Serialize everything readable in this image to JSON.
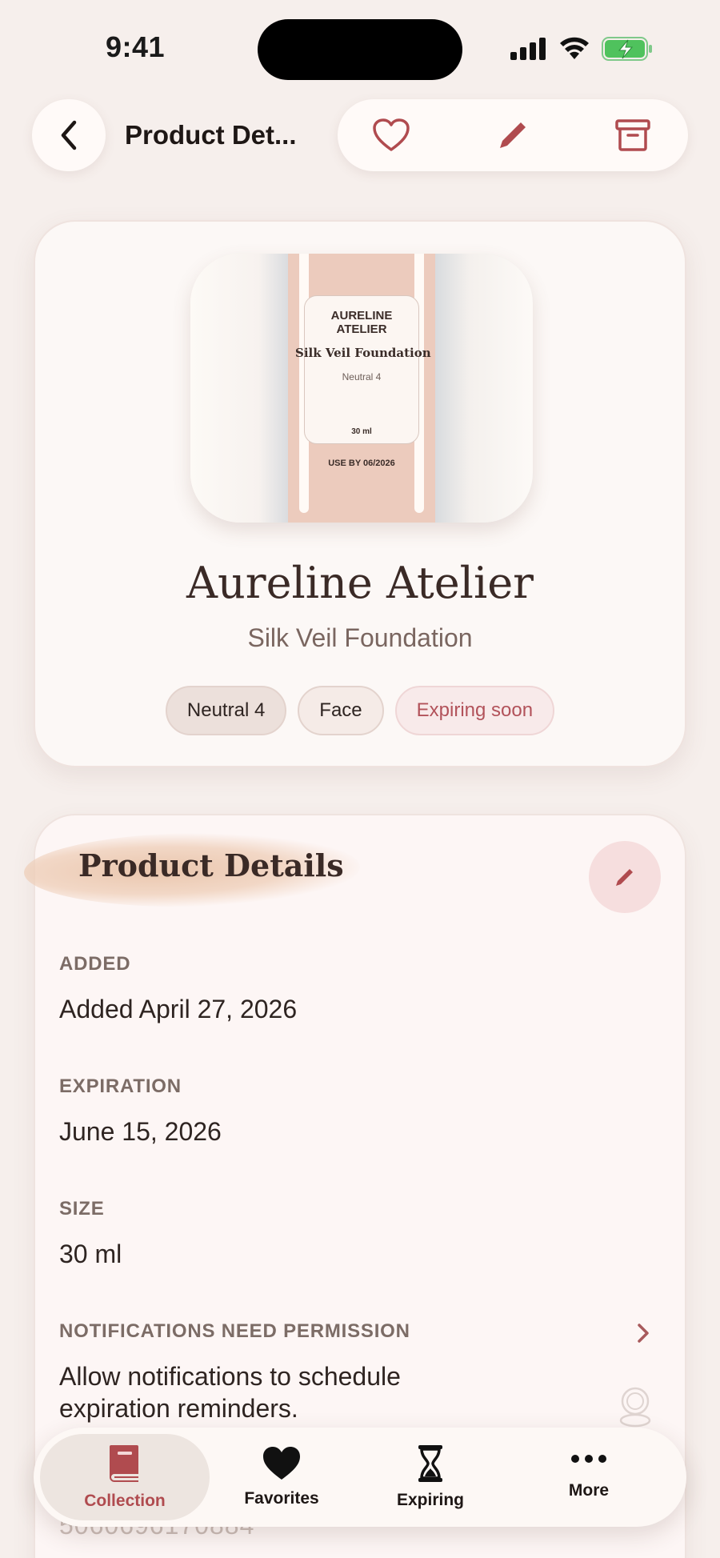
{
  "status_bar": {
    "time": "9:41"
  },
  "header": {
    "title": "Product Det..."
  },
  "product": {
    "brand": "Aureline Atelier",
    "name": "Silk Veil Foundation",
    "chips": [
      "Neutral 4",
      "Face",
      "Expiring soon"
    ],
    "label": {
      "brand": "AURELINE ATELIER",
      "name": "Silk Veil Foundation",
      "shade": "Neutral 4",
      "size": "30 ml",
      "use_by": "USE BY 06/2026"
    }
  },
  "details": {
    "title": "Product Details",
    "fields": [
      {
        "label": "ADDED",
        "value": "Added April 27, 2026"
      },
      {
        "label": "EXPIRATION",
        "value": "June 15, 2026"
      },
      {
        "label": "SIZE",
        "value": "30 ml"
      },
      {
        "label": "NOTIFICATIONS NEED PERMISSION",
        "value": "Allow notifications to schedule expiration reminders."
      }
    ],
    "barcode_partial": "5060696170884"
  },
  "tabs": [
    {
      "label": "Collection",
      "icon": "book-icon",
      "active": true
    },
    {
      "label": "Favorites",
      "icon": "heart-icon",
      "active": false
    },
    {
      "label": "Expiring",
      "icon": "hourglass-icon",
      "active": false
    },
    {
      "label": "More",
      "icon": "ellipsis-icon",
      "active": false
    }
  ],
  "colors": {
    "accent": "#b04b4f",
    "background": "#f6efec",
    "card": "#fcf8f6"
  }
}
